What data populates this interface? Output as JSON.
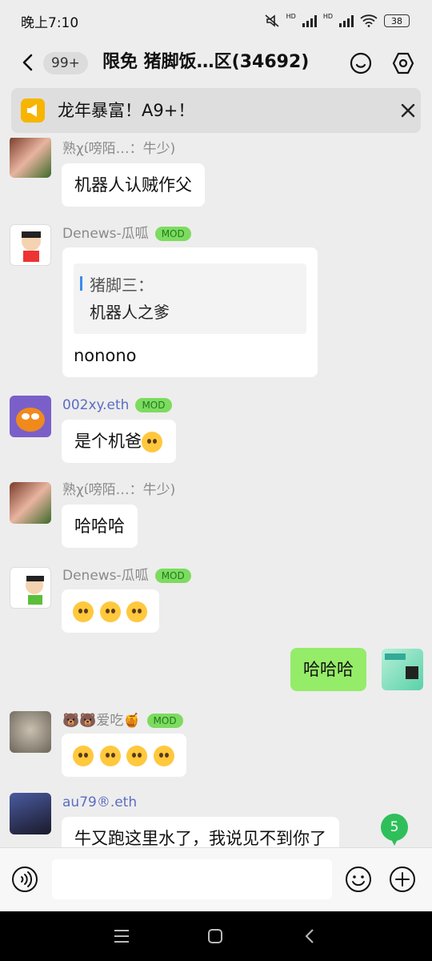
{
  "status_bar": {
    "time": "晚上7:10",
    "hd1": "HD",
    "hd2": "HD",
    "battery": "38"
  },
  "header": {
    "unread_count": "99+",
    "title": "限免 猪脚饭…区(34692)"
  },
  "notice": {
    "text": "龙年暴富！A9+！"
  },
  "messages": [
    {
      "sender": "熟χί嗙陌…：牛少)",
      "text": "机器人认贼作父"
    },
    {
      "sender": "Denews-瓜呱",
      "badge": "MOD",
      "quote_name": "猪脚三：",
      "quote_text": "机器人之爹",
      "text": "nonono"
    },
    {
      "sender": "002xy.eth",
      "badge": "MOD",
      "text": "是个机爸"
    },
    {
      "sender": "熟χί嗙陌…：牛少)",
      "text": "哈哈哈"
    },
    {
      "sender": "Denews-瓜呱",
      "badge": "MOD",
      "emoji_count": 3
    },
    {
      "self": true,
      "text": "哈哈哈"
    },
    {
      "sender": "🐻🐻爱吃🍯",
      "badge": "MOD",
      "emoji_count": 4
    },
    {
      "sender": "au79®.eth",
      "text": "牛又跑这里水了，我说见不到你了"
    }
  ],
  "unread_badge": "5",
  "input": {
    "placeholder": ""
  },
  "colors": {
    "accent_green": "#95ec69",
    "mod_badge": "#7ddb5f",
    "background": "#ededed"
  },
  "icons": [
    "back-icon",
    "smiley-icon",
    "hexagon-settings-icon",
    "megaphone-icon",
    "close-icon",
    "voice-icon",
    "emoji-icon",
    "plus-icon",
    "menu-icon",
    "home-icon",
    "nav-back-icon"
  ]
}
